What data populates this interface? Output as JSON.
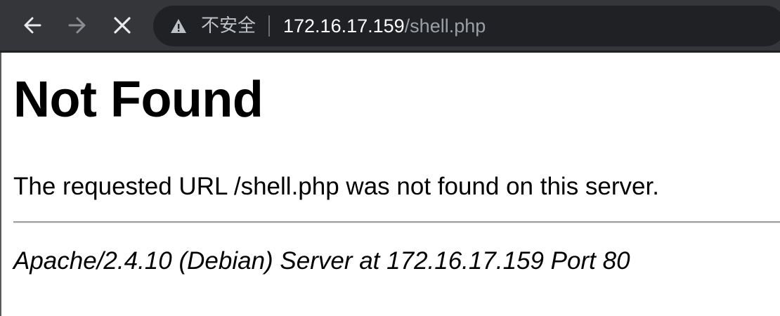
{
  "browser": {
    "security_label": "不安全",
    "url_host": "172.16.17.159",
    "url_path": "/shell.php",
    "icons": {
      "back": "arrow-left",
      "forward": "arrow-right",
      "stop": "close-x",
      "warning": "warning-triangle"
    }
  },
  "page": {
    "title": "Not Found",
    "message": "The requested URL /shell.php was not found on this server.",
    "server_signature": "Apache/2.4.10 (Debian) Server at 172.16.17.159 Port 80"
  },
  "colors": {
    "toolbar_bg": "#35363a",
    "omnibox_bg": "#202124",
    "url_host": "#ffffff",
    "url_path": "#9aa0a6"
  }
}
